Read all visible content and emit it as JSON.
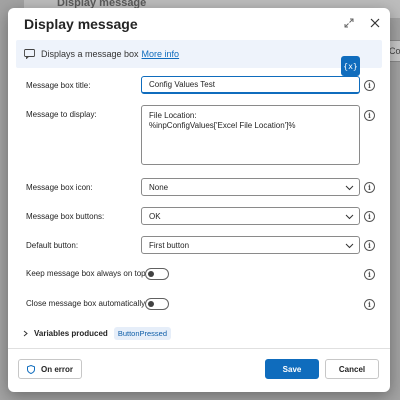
{
  "background": {
    "card_title": "Display message",
    "right_panel_text": "Cox"
  },
  "dialog": {
    "title": "Display message",
    "expand_icon": "expand-icon",
    "close_icon": "close-icon",
    "info": {
      "text": "Displays a message box",
      "link": "More info"
    },
    "variables_badge": "{x}"
  },
  "fields": {
    "title": {
      "label": "Message box title:",
      "value": "Config Values Test"
    },
    "message": {
      "label": "Message to display:",
      "lines": [
        "File Location:",
        "%inpConfigValues['Excel File Location']%"
      ]
    },
    "icon": {
      "label": "Message box icon:",
      "value": "None"
    },
    "buttons": {
      "label": "Message box buttons:",
      "value": "OK"
    },
    "default_button": {
      "label": "Default button:",
      "value": "First button"
    },
    "always_on_top": {
      "label": "Keep message box always on top:",
      "on": false
    },
    "auto_close": {
      "label": "Close message box automatically:",
      "on": false
    }
  },
  "variables_produced": {
    "label": "Variables produced",
    "chip": "ButtonPressed"
  },
  "footer": {
    "on_error": "On error",
    "save": "Save",
    "cancel": "Cancel"
  },
  "colors": {
    "accent": "#0f6cbd",
    "info_bar_bg": "#eef3fb",
    "chip_bg": "#e6eef9"
  }
}
